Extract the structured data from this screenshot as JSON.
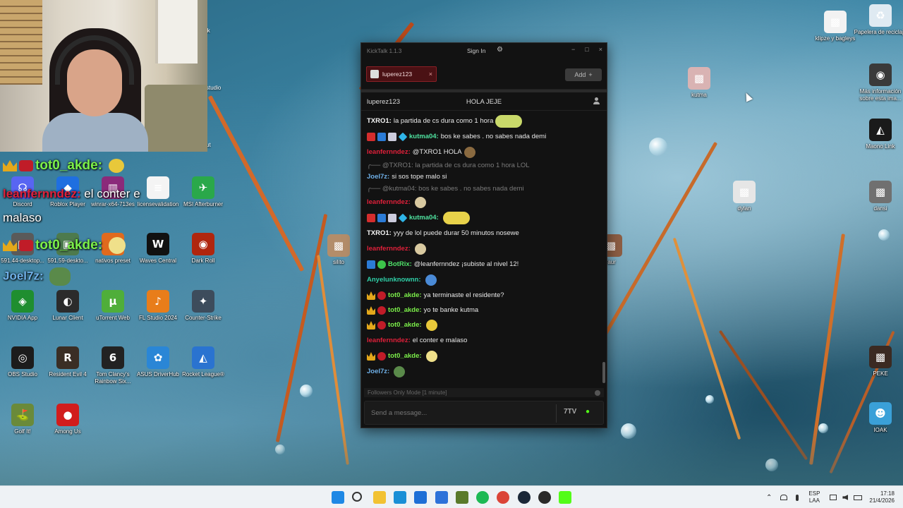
{
  "desktop": {
    "icons_left": [
      {
        "label": "Discord",
        "glyph": "☊",
        "color": "#5865f2"
      },
      {
        "label": "Roblox Player",
        "glyph": "◆",
        "color": "#1f6fe0"
      },
      {
        "label": "winrar-x64-713es",
        "glyph": "▥",
        "color": "#8b2a7a"
      },
      {
        "label": "licensevalidation",
        "glyph": "≡",
        "color": "#f4f4f4"
      },
      {
        "label": "MSI Afterburner",
        "glyph": "✈",
        "color": "#2aa84a"
      },
      {
        "label": "591.44-desktop...",
        "glyph": "▣",
        "color": "#5a5a5a"
      },
      {
        "label": "591.59-deskto...",
        "glyph": "▣",
        "color": "#4d7a4d"
      },
      {
        "label": "nativos preset",
        "glyph": "●",
        "color": "#e06a1e"
      },
      {
        "label": "Waves Central",
        "glyph": "W",
        "color": "#111111"
      },
      {
        "label": "Dark Roll",
        "glyph": "◉",
        "color": "#b0260e"
      },
      {
        "label": "NVIDIA App",
        "glyph": "◈",
        "color": "#1f8e2f"
      },
      {
        "label": "Lunar Client",
        "glyph": "◐",
        "color": "#2b2b2b"
      },
      {
        "label": "uTorrent Web",
        "glyph": "µ",
        "color": "#4fae3a"
      },
      {
        "label": "FL Studio 2024",
        "glyph": "♪",
        "color": "#e87d1a"
      },
      {
        "label": "Counter-Strike",
        "glyph": "✦",
        "color": "#3d4c5c"
      },
      {
        "label": "OBS Studio",
        "glyph": "◎",
        "color": "#1c1c1c"
      },
      {
        "label": "Resident Evil 4",
        "glyph": "R",
        "color": "#3a2e25"
      },
      {
        "label": "Tom Clancy's Rainbow Six...",
        "glyph": "6",
        "color": "#222222"
      },
      {
        "label": "ASUS DriverHub",
        "glyph": "✿",
        "color": "#2a86d6"
      },
      {
        "label": "Rocket League®",
        "glyph": "◭",
        "color": "#2a73d0"
      },
      {
        "label": "Golf It!",
        "glyph": "⛳",
        "color": "#6a8a3a"
      },
      {
        "label": "Among Us",
        "glyph": "●",
        "color": "#d11d1d"
      }
    ],
    "icons_misc": [
      {
        "label": "silito",
        "glyph": "▩",
        "color": "#b38d6a"
      },
      {
        "label": "faur",
        "glyph": "▩",
        "color": "#8d5e44"
      },
      {
        "label": "kutma",
        "glyph": "▩",
        "color": "#d9b3b3"
      },
      {
        "label": "dylan",
        "glyph": "▩",
        "color": "#e6e6e6"
      },
      {
        "label": "dansi",
        "glyph": "▩",
        "color": "#707070"
      },
      {
        "label": "klipze y bagleys",
        "glyph": "▩",
        "color": "#f2f2f2"
      },
      {
        "label": "Papelera de reciclaje",
        "glyph": "♻",
        "color": "#dfeaf2"
      },
      {
        "label": "Más información sobre esta ima...",
        "glyph": "◉",
        "color": "#3a3a3a"
      },
      {
        "label": "Maono Link",
        "glyph": "◭",
        "color": "#1a1a1a"
      },
      {
        "label": "PEKE",
        "glyph": "▩",
        "color": "#3b2a22"
      },
      {
        "label": "IOAK",
        "glyph": "☻",
        "color": "#3aa0d8"
      }
    ],
    "partial_labels": [
      "lk",
      "studio",
      "ut"
    ]
  },
  "overlay_chat": [
    {
      "user": "tot0_akde:",
      "text": "",
      "color": "#7cf04a"
    },
    {
      "user": "leanfernndez:",
      "text": "el conter e",
      "color": "#e0203a"
    },
    {
      "user": "",
      "text": "malaso",
      "color": "#ffffff"
    },
    {
      "user": "tot0_akde:",
      "text": "",
      "color": "#7cf04a"
    },
    {
      "user": "Joel7z:",
      "text": "",
      "color": "#6fb0e8"
    }
  ],
  "kicktalk": {
    "app_title": "KickTalk 1.1.3",
    "sign_in": "Sign In",
    "gear": "⚙",
    "minimize": "−",
    "maximize": "□",
    "close": "×",
    "tab_label": "luperez123",
    "tab_close": "×",
    "add_label": "Add",
    "add_icon": "+",
    "channel_name": "luperez123",
    "stream_title": "HOLA JEJE",
    "messages": [
      {
        "badges": [],
        "user": "TXRO1:",
        "color": "#f5f5f5",
        "text": "la partida de cs dura como 1 hora",
        "emote": "#c9d96a"
      },
      {
        "badges": [
          "sub",
          "blue",
          "gray",
          "cyan"
        ],
        "user": "kutma04:",
        "color": "#4fe3a0",
        "text": "bos ke sabes . no sabes nada demi",
        "emote": ""
      },
      {
        "badges": [],
        "user": "leanfernndez:",
        "color": "#e0203a",
        "text": "@TXRO1 HOLA",
        "emote": "#8a6a40",
        "small": true
      },
      {
        "badges": [],
        "user": "",
        "color": "#7a7a7a",
        "reply": "╭── @TXRO1: la partida de cs dura como 1 hora LOL",
        "text": "",
        "emote": ""
      },
      {
        "badges": [],
        "user": "Joel7z:",
        "color": "#6fb0e8",
        "text": "si sos tope malo si",
        "emote": ""
      },
      {
        "badges": [],
        "user": "",
        "color": "#7a7a7a",
        "reply": "╭── @kutma04: bos ke sabes . no sabes nada demi",
        "text": "",
        "emote": ""
      },
      {
        "badges": [],
        "user": "leanfernndez:",
        "color": "#e0203a",
        "text": "",
        "emote": "#d8c9a0",
        "small": true
      },
      {
        "badges": [
          "sub",
          "blue",
          "gray",
          "cyan"
        ],
        "user": "kutma04:",
        "color": "#4fe3a0",
        "text": "",
        "emote": "#e8d24a"
      },
      {
        "badges": [],
        "user": "TXRO1:",
        "color": "#f5f5f5",
        "text": "yyy de lol puede durar 50 minutos nosewe",
        "emote": ""
      },
      {
        "badges": [],
        "user": "leanfernndez:",
        "color": "#e0203a",
        "text": "",
        "emote": "#d8c9a0",
        "small": true
      },
      {
        "badges": [
          "blue",
          "green"
        ],
        "user": "BotRix:",
        "color": "#4fe36a",
        "text": "@leanfernndez ¡subiste al nivel 12!",
        "emote": ""
      },
      {
        "badges": [],
        "user": "Anyelunknownn:",
        "color": "#2fd0a8",
        "text": "",
        "emote": "#4a8ad6",
        "small": true
      },
      {
        "badges": [
          "crown",
          "red"
        ],
        "user": "tot0_akde:",
        "color": "#7cf04a",
        "text": "ya terminaste el residente?",
        "emote": ""
      },
      {
        "badges": [
          "crown",
          "red"
        ],
        "user": "tot0_akde:",
        "color": "#7cf04a",
        "text": "yo te banke kutma",
        "emote": ""
      },
      {
        "badges": [
          "crown",
          "red"
        ],
        "user": "tot0_akde:",
        "color": "#7cf04a",
        "text": "",
        "emote": "#e8c83a",
        "small": true
      },
      {
        "badges": [],
        "user": "leanfernndez:",
        "color": "#e0203a",
        "text": "el conter e malaso",
        "emote": ""
      },
      {
        "badges": [
          "crown",
          "red"
        ],
        "user": "tot0_akde:",
        "color": "#7cf04a",
        "text": "",
        "emote": "#efe08a",
        "small": true
      },
      {
        "badges": [],
        "user": "Joel7z:",
        "color": "#6fb0e8",
        "text": "",
        "emote": "#5a8a4a",
        "small": true
      }
    ],
    "followers_mode": "Followers Only Mode [1 minute]",
    "input_placeholder": "Send a message...",
    "emote_picker_7tv": "7TV",
    "emote_picker_kick": "●"
  },
  "taskbar": {
    "language": "ESP",
    "layout": "LAA",
    "time": "17:18",
    "date": "21/4/2026",
    "chevron": "⌃",
    "apps": [
      {
        "name": "start-icon",
        "color": "#1e88e5"
      },
      {
        "name": "search-icon",
        "color": "#333333"
      },
      {
        "name": "file-explorer-icon",
        "color": "#f2c232"
      },
      {
        "name": "edge-icon",
        "color": "#1a8fd6"
      },
      {
        "name": "store-icon",
        "color": "#1e6fd6"
      },
      {
        "name": "outlook-icon",
        "color": "#2d72d9"
      },
      {
        "name": "minecraft-icon",
        "color": "#5a7a2a"
      },
      {
        "name": "spotify-icon",
        "color": "#1db954"
      },
      {
        "name": "chrome-icon",
        "color": "#db4437"
      },
      {
        "name": "steam-icon",
        "color": "#1b2838"
      },
      {
        "name": "obs-icon",
        "color": "#2a2a2a"
      },
      {
        "name": "kick-icon",
        "color": "#53fc18"
      }
    ]
  }
}
